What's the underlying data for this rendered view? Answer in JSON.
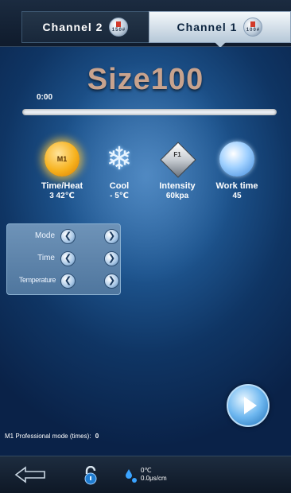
{
  "tabs": [
    {
      "label": "Channel 2",
      "chip": "150#"
    },
    {
      "label": "Channel 1",
      "chip": "100#"
    }
  ],
  "title": "Size100",
  "elapsed": "0:00",
  "progress": 0,
  "params": [
    {
      "label": "Time/Heat",
      "value": "3  42℃",
      "icon": "sun-icon",
      "icon_text": "M1"
    },
    {
      "label": "Cool",
      "value": "- 5℃",
      "icon": "snowflake-icon"
    },
    {
      "label": "Intensity",
      "value": "60kpa",
      "icon": "diamond-pyramid-icon",
      "icon_text": "F1"
    },
    {
      "label": "Work time",
      "value": "45",
      "icon": "globe-icon"
    }
  ],
  "settings": [
    {
      "label": "Mode"
    },
    {
      "label": "Time"
    },
    {
      "label": "Temperature"
    }
  ],
  "footer": {
    "label": "M1 Professional mode (times):",
    "value": "0"
  },
  "status": {
    "temp": "0℃",
    "conductivity": "0.0μs/cm"
  },
  "colors": {
    "accent": "#1e6fb6",
    "background": "#0f3564"
  }
}
